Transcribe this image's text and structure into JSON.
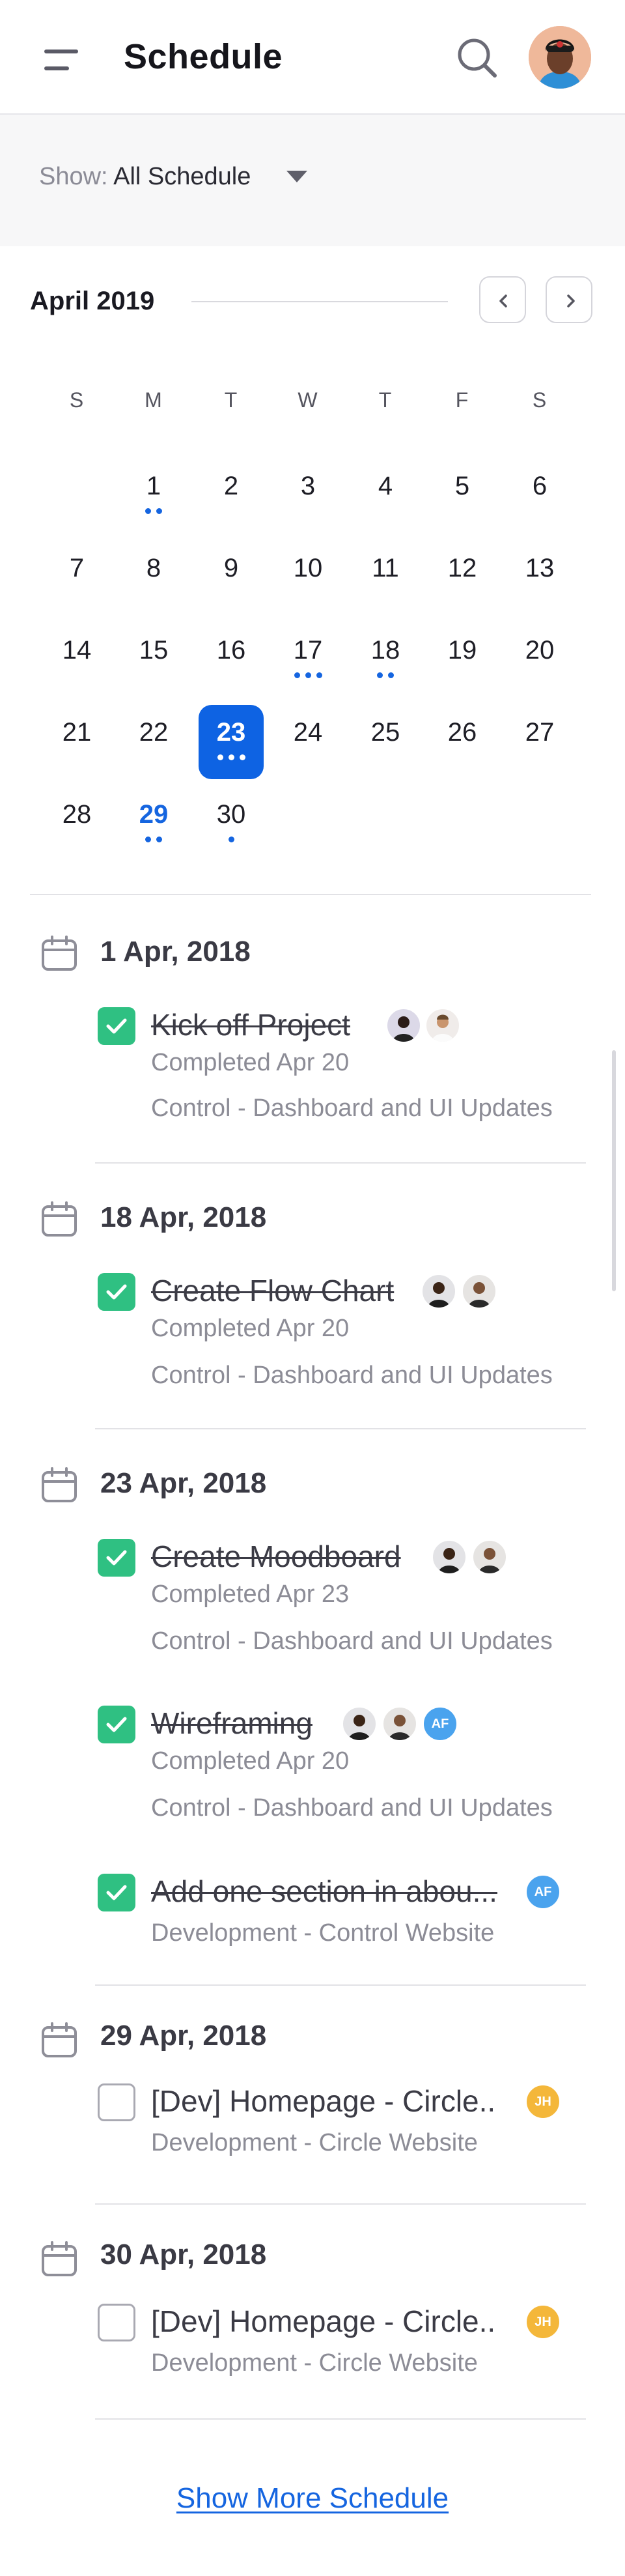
{
  "header": {
    "title": "Schedule",
    "menu_icon": "menu-icon",
    "search_icon": "search-icon"
  },
  "filter": {
    "label": "Show:",
    "value": "All Schedule"
  },
  "calendar": {
    "month": "April 2019",
    "weekdays": [
      "S",
      "M",
      "T",
      "W",
      "T",
      "F",
      "S"
    ],
    "days": [
      "1",
      "2",
      "3",
      "4",
      "5",
      "6",
      "7",
      "8",
      "9",
      "10",
      "11",
      "12",
      "13",
      "14",
      "15",
      "16",
      "17",
      "18",
      "19",
      "20",
      "21",
      "22",
      "23",
      "24",
      "25",
      "26",
      "27",
      "28",
      "29",
      "30"
    ],
    "selected_day": "23",
    "highlight_day": "29"
  },
  "schedule": [
    {
      "date": "1 Apr, 2018",
      "tasks": [
        {
          "title": "Kick off Project",
          "meta": "Completed Apr 20",
          "project": "Control - Dashboard and UI Updates"
        }
      ]
    },
    {
      "date": "18 Apr, 2018",
      "tasks": [
        {
          "title": "Create Flow Chart",
          "meta": "Completed Apr 20",
          "project": "Control - Dashboard and UI Updates"
        }
      ]
    },
    {
      "date": "23 Apr, 2018",
      "tasks": [
        {
          "title": "Create Moodboard",
          "meta": "Completed Apr 23",
          "project": "Control - Dashboard and UI Updates"
        },
        {
          "title": "Wireframing",
          "meta": "Completed Apr 20",
          "project": "Control - Dashboard and UI Updates",
          "initials": "AF"
        },
        {
          "title": "Add one section in abou...",
          "project": "Development - Control Website",
          "initials": "AF"
        }
      ]
    },
    {
      "date": "29 Apr, 2018",
      "tasks": [
        {
          "title": "[Dev] Homepage - Circle..",
          "project": "Development - Circle Website",
          "initials": "JH"
        }
      ]
    },
    {
      "date": "30 Apr, 2018",
      "tasks": [
        {
          "title": "[Dev] Homepage - Circle..",
          "project": "Development - Circle Website",
          "initials": "JH"
        }
      ]
    }
  ],
  "colors": {
    "accent": "#0e63e3",
    "done": "#2fc082",
    "af_badge": "#4aa3ee",
    "jh_badge": "#f4b73a"
  },
  "show_more": "Show More Schedule"
}
